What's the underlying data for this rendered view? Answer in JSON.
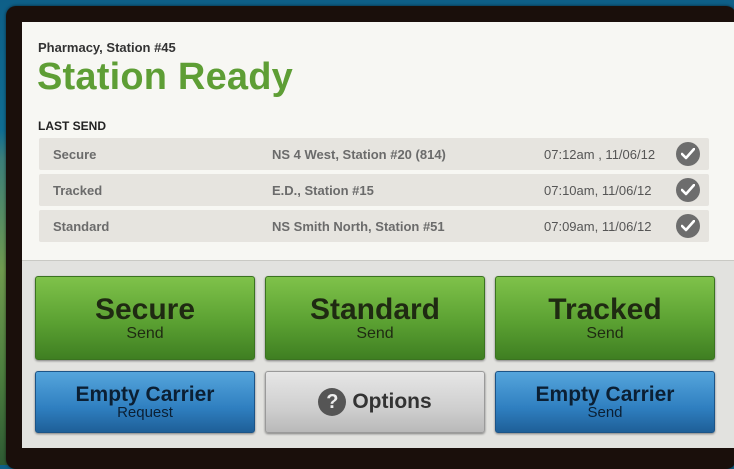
{
  "header": {
    "location": "Pharmacy, Station #45",
    "status": "Station Ready",
    "last_send_label": "LAST SEND"
  },
  "last_send": [
    {
      "type": "Secure",
      "destination": "NS 4 West, Station #20 (814)",
      "time": "07:12am , 11/06/12"
    },
    {
      "type": "Tracked",
      "destination": "E.D., Station #15",
      "time": "07:10am,  11/06/12"
    },
    {
      "type": "Standard",
      "destination": "NS Smith North, Station #51",
      "time": "07:09am,  11/06/12"
    }
  ],
  "buttons": {
    "secure": {
      "title": "Secure",
      "sub": "Send"
    },
    "standard": {
      "title": "Standard",
      "sub": "Send"
    },
    "tracked": {
      "title": "Tracked",
      "sub": "Send"
    },
    "empty_request": {
      "title": "Empty Carrier",
      "sub": "Request"
    },
    "options": {
      "label": "Options",
      "icon": "question-icon",
      "glyph": "?"
    },
    "empty_send": {
      "title": "Empty Carrier",
      "sub": "Send"
    }
  },
  "colors": {
    "status_green": "#5e9e35",
    "send_green": "#5ba132",
    "empty_blue": "#2f7fc0",
    "options_gray": "#cfcfcf"
  }
}
